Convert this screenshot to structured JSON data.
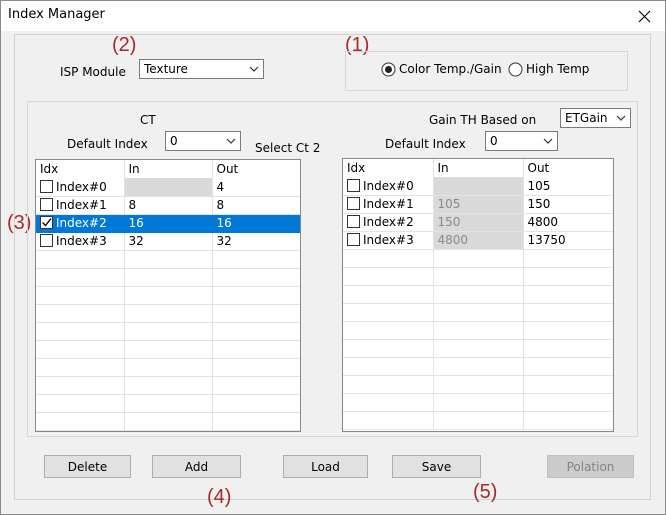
{
  "window": {
    "title": "Index Manager"
  },
  "annotations": {
    "a1": "(1)",
    "a2": "(2)",
    "a3": "(3)",
    "a4": "(4)",
    "a5": "(5)"
  },
  "isp": {
    "label": "ISP Module",
    "value": "Texture"
  },
  "mode": {
    "color_temp_label": "Color Temp./Gain",
    "high_temp_label": "High Temp",
    "selected": "Color Temp./Gain"
  },
  "ct": {
    "title": "CT",
    "default_index_label": "Default Index",
    "default_index_value": "0",
    "select_label": "Select Ct 2",
    "columns": [
      "Idx",
      "In",
      "Out"
    ],
    "rows": [
      {
        "idx": "Index#0",
        "in": "",
        "out": "4",
        "checked": false,
        "selected": false
      },
      {
        "idx": "Index#1",
        "in": "8",
        "out": "8",
        "checked": false,
        "selected": false
      },
      {
        "idx": "Index#2",
        "in": "16",
        "out": "16",
        "checked": true,
        "selected": true
      },
      {
        "idx": "Index#3",
        "in": "32",
        "out": "32",
        "checked": false,
        "selected": false
      }
    ]
  },
  "gain": {
    "th_label": "Gain TH Based on",
    "th_value": "ETGain",
    "default_index_label": "Default Index",
    "default_index_value": "0",
    "columns": [
      "Idx",
      "In",
      "Out"
    ],
    "rows": [
      {
        "idx": "Index#0",
        "in": "",
        "out": "105",
        "checked": false
      },
      {
        "idx": "Index#1",
        "in": "105",
        "out": "150",
        "checked": false
      },
      {
        "idx": "Index#2",
        "in": "150",
        "out": "4800",
        "checked": false
      },
      {
        "idx": "Index#3",
        "in": "4800",
        "out": "13750",
        "checked": false
      }
    ]
  },
  "buttons": {
    "delete": "Delete",
    "add": "Add",
    "load": "Load",
    "save": "Save",
    "polation": "Polation"
  },
  "colors": {
    "selection": "#0078d7",
    "annotation": "#a52a2a"
  }
}
